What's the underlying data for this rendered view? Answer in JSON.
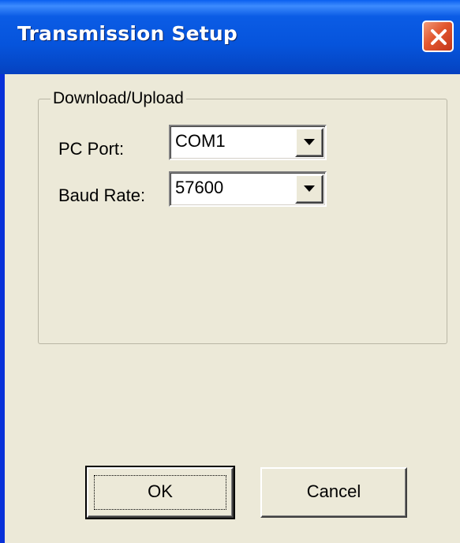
{
  "window": {
    "title": "Transmission Setup",
    "close_icon": "close-icon",
    "colors": {
      "titlebar": "#0654DC",
      "close_button": "#E2572E",
      "client": "#ECE9D8"
    }
  },
  "group": {
    "label": "Download/Upload"
  },
  "fields": {
    "pc_port": {
      "label": "PC Port:",
      "value": "COM1"
    },
    "baud_rate": {
      "label": "Baud Rate:",
      "value": "57600"
    }
  },
  "buttons": {
    "ok": "OK",
    "cancel": "Cancel"
  }
}
